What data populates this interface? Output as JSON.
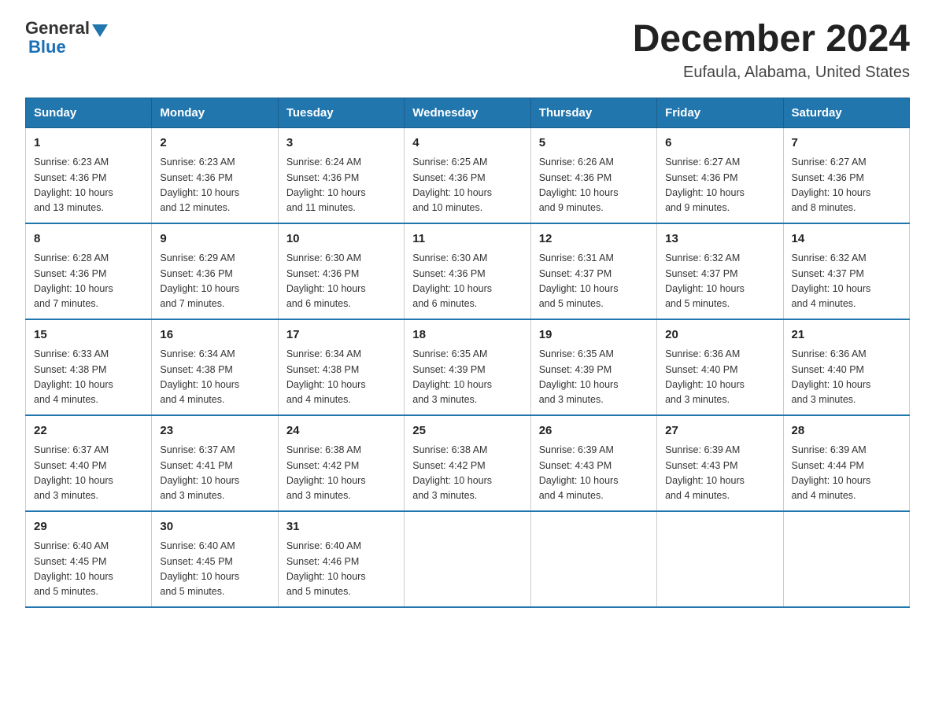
{
  "logo": {
    "general": "General",
    "blue": "Blue"
  },
  "title": "December 2024",
  "location": "Eufaula, Alabama, United States",
  "days_of_week": [
    "Sunday",
    "Monday",
    "Tuesday",
    "Wednesday",
    "Thursday",
    "Friday",
    "Saturday"
  ],
  "weeks": [
    [
      {
        "day": "1",
        "sunrise": "6:23 AM",
        "sunset": "4:36 PM",
        "daylight": "10 hours and 13 minutes."
      },
      {
        "day": "2",
        "sunrise": "6:23 AM",
        "sunset": "4:36 PM",
        "daylight": "10 hours and 12 minutes."
      },
      {
        "day": "3",
        "sunrise": "6:24 AM",
        "sunset": "4:36 PM",
        "daylight": "10 hours and 11 minutes."
      },
      {
        "day": "4",
        "sunrise": "6:25 AM",
        "sunset": "4:36 PM",
        "daylight": "10 hours and 10 minutes."
      },
      {
        "day": "5",
        "sunrise": "6:26 AM",
        "sunset": "4:36 PM",
        "daylight": "10 hours and 9 minutes."
      },
      {
        "day": "6",
        "sunrise": "6:27 AM",
        "sunset": "4:36 PM",
        "daylight": "10 hours and 9 minutes."
      },
      {
        "day": "7",
        "sunrise": "6:27 AM",
        "sunset": "4:36 PM",
        "daylight": "10 hours and 8 minutes."
      }
    ],
    [
      {
        "day": "8",
        "sunrise": "6:28 AM",
        "sunset": "4:36 PM",
        "daylight": "10 hours and 7 minutes."
      },
      {
        "day": "9",
        "sunrise": "6:29 AM",
        "sunset": "4:36 PM",
        "daylight": "10 hours and 7 minutes."
      },
      {
        "day": "10",
        "sunrise": "6:30 AM",
        "sunset": "4:36 PM",
        "daylight": "10 hours and 6 minutes."
      },
      {
        "day": "11",
        "sunrise": "6:30 AM",
        "sunset": "4:36 PM",
        "daylight": "10 hours and 6 minutes."
      },
      {
        "day": "12",
        "sunrise": "6:31 AM",
        "sunset": "4:37 PM",
        "daylight": "10 hours and 5 minutes."
      },
      {
        "day": "13",
        "sunrise": "6:32 AM",
        "sunset": "4:37 PM",
        "daylight": "10 hours and 5 minutes."
      },
      {
        "day": "14",
        "sunrise": "6:32 AM",
        "sunset": "4:37 PM",
        "daylight": "10 hours and 4 minutes."
      }
    ],
    [
      {
        "day": "15",
        "sunrise": "6:33 AM",
        "sunset": "4:38 PM",
        "daylight": "10 hours and 4 minutes."
      },
      {
        "day": "16",
        "sunrise": "6:34 AM",
        "sunset": "4:38 PM",
        "daylight": "10 hours and 4 minutes."
      },
      {
        "day": "17",
        "sunrise": "6:34 AM",
        "sunset": "4:38 PM",
        "daylight": "10 hours and 4 minutes."
      },
      {
        "day": "18",
        "sunrise": "6:35 AM",
        "sunset": "4:39 PM",
        "daylight": "10 hours and 3 minutes."
      },
      {
        "day": "19",
        "sunrise": "6:35 AM",
        "sunset": "4:39 PM",
        "daylight": "10 hours and 3 minutes."
      },
      {
        "day": "20",
        "sunrise": "6:36 AM",
        "sunset": "4:40 PM",
        "daylight": "10 hours and 3 minutes."
      },
      {
        "day": "21",
        "sunrise": "6:36 AM",
        "sunset": "4:40 PM",
        "daylight": "10 hours and 3 minutes."
      }
    ],
    [
      {
        "day": "22",
        "sunrise": "6:37 AM",
        "sunset": "4:40 PM",
        "daylight": "10 hours and 3 minutes."
      },
      {
        "day": "23",
        "sunrise": "6:37 AM",
        "sunset": "4:41 PM",
        "daylight": "10 hours and 3 minutes."
      },
      {
        "day": "24",
        "sunrise": "6:38 AM",
        "sunset": "4:42 PM",
        "daylight": "10 hours and 3 minutes."
      },
      {
        "day": "25",
        "sunrise": "6:38 AM",
        "sunset": "4:42 PM",
        "daylight": "10 hours and 3 minutes."
      },
      {
        "day": "26",
        "sunrise": "6:39 AM",
        "sunset": "4:43 PM",
        "daylight": "10 hours and 4 minutes."
      },
      {
        "day": "27",
        "sunrise": "6:39 AM",
        "sunset": "4:43 PM",
        "daylight": "10 hours and 4 minutes."
      },
      {
        "day": "28",
        "sunrise": "6:39 AM",
        "sunset": "4:44 PM",
        "daylight": "10 hours and 4 minutes."
      }
    ],
    [
      {
        "day": "29",
        "sunrise": "6:40 AM",
        "sunset": "4:45 PM",
        "daylight": "10 hours and 5 minutes."
      },
      {
        "day": "30",
        "sunrise": "6:40 AM",
        "sunset": "4:45 PM",
        "daylight": "10 hours and 5 minutes."
      },
      {
        "day": "31",
        "sunrise": "6:40 AM",
        "sunset": "4:46 PM",
        "daylight": "10 hours and 5 minutes."
      },
      null,
      null,
      null,
      null
    ]
  ],
  "labels": {
    "sunrise": "Sunrise:",
    "sunset": "Sunset:",
    "daylight": "Daylight:"
  }
}
